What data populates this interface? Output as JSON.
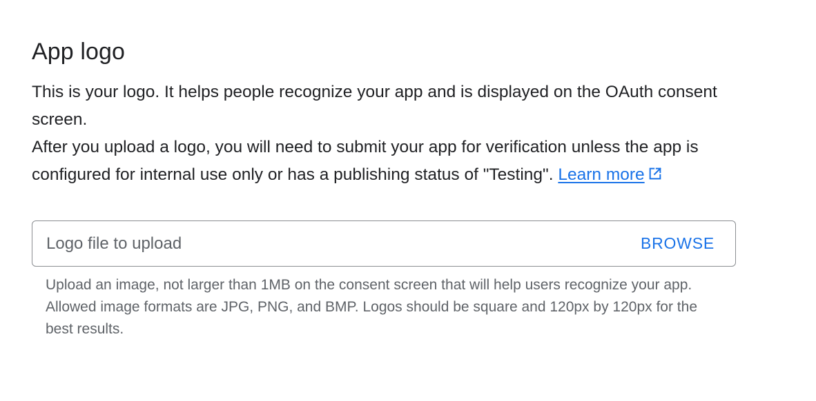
{
  "section": {
    "title": "App logo",
    "description_line1": "This is your logo. It helps people recognize your app and is displayed on the OAuth consent screen.",
    "description_line2": "After you upload a logo, you will need to submit your app for verification unless the app is configured for internal use only or has a publishing status of \"Testing\".",
    "learn_more_label": "Learn more",
    "learn_more_icon": "open-in-new-icon"
  },
  "upload": {
    "placeholder": "Logo file to upload",
    "browse_label": "BROWSE",
    "hint": "Upload an image, not larger than 1MB on the consent screen that will help users recognize your app. Allowed image formats are JPG, PNG, and BMP. Logos should be square and 120px by 120px for the best results."
  },
  "colors": {
    "accent": "#1a73e8",
    "text": "#202124",
    "secondary_text": "#5f6368",
    "border": "#8a8d91"
  }
}
